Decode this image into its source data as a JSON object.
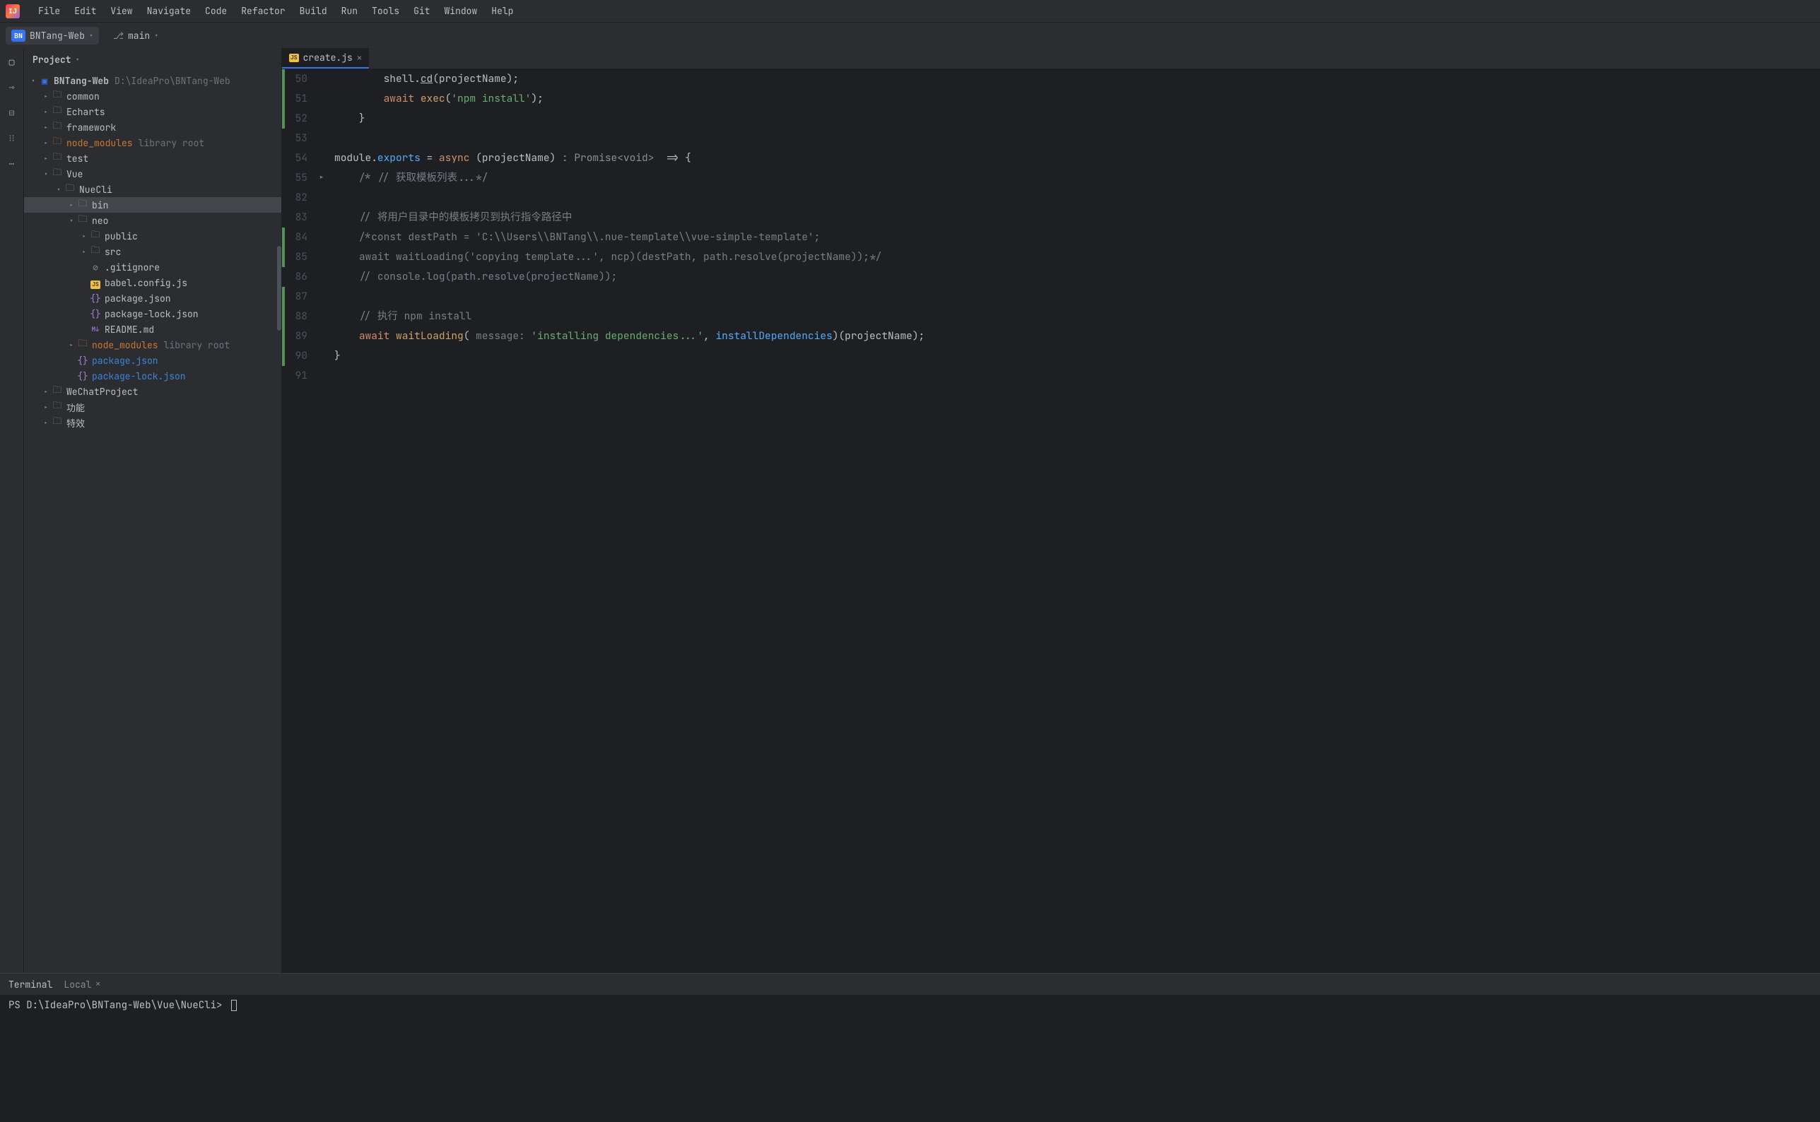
{
  "menu": [
    "File",
    "Edit",
    "View",
    "Navigate",
    "Code",
    "Refactor",
    "Build",
    "Run",
    "Tools",
    "Git",
    "Window",
    "Help"
  ],
  "project": {
    "badge": "BN",
    "name": "BNTang-Web",
    "branch": "main"
  },
  "panel": {
    "title": "Project"
  },
  "tree": {
    "root": {
      "name": "BNTang-Web",
      "path": "D:\\IdeaPro\\BNTang-Web"
    },
    "items": [
      {
        "indent": 1,
        "arrow": ">",
        "icon": "folder",
        "label": "common"
      },
      {
        "indent": 1,
        "arrow": ">",
        "icon": "folder",
        "label": "Echarts"
      },
      {
        "indent": 1,
        "arrow": ">",
        "icon": "folder",
        "label": "framework"
      },
      {
        "indent": 1,
        "arrow": ">",
        "icon": "excluded",
        "label": "node_modules",
        "hint": "library root"
      },
      {
        "indent": 1,
        "arrow": ">",
        "icon": "folder",
        "label": "test"
      },
      {
        "indent": 1,
        "arrow": "v",
        "icon": "folder",
        "label": "Vue"
      },
      {
        "indent": 2,
        "arrow": "v",
        "icon": "folder",
        "label": "NueCli"
      },
      {
        "indent": 3,
        "arrow": ">",
        "icon": "folder",
        "label": "bin",
        "selected": true
      },
      {
        "indent": 3,
        "arrow": "v",
        "icon": "folder",
        "label": "neo"
      },
      {
        "indent": 4,
        "arrow": ">",
        "icon": "folder",
        "label": "public"
      },
      {
        "indent": 4,
        "arrow": ">",
        "icon": "folder",
        "label": "src"
      },
      {
        "indent": 4,
        "arrow": "",
        "icon": "gitignore",
        "label": ".gitignore"
      },
      {
        "indent": 4,
        "arrow": "",
        "icon": "js",
        "label": "babel.config.js"
      },
      {
        "indent": 4,
        "arrow": "",
        "icon": "json",
        "label": "package.json"
      },
      {
        "indent": 4,
        "arrow": "",
        "icon": "json",
        "label": "package-lock.json"
      },
      {
        "indent": 4,
        "arrow": "",
        "icon": "md",
        "label": "README.md"
      },
      {
        "indent": 3,
        "arrow": ">",
        "icon": "excluded",
        "label": "node_modules",
        "hint": "library root"
      },
      {
        "indent": 3,
        "arrow": "",
        "icon": "json",
        "label": "package.json",
        "modified": true
      },
      {
        "indent": 3,
        "arrow": "",
        "icon": "json",
        "label": "package-lock.json",
        "modified": true
      },
      {
        "indent": 1,
        "arrow": ">",
        "icon": "folder",
        "label": "WeChatProject"
      },
      {
        "indent": 1,
        "arrow": ">",
        "icon": "folder",
        "label": "功能"
      },
      {
        "indent": 1,
        "arrow": ">",
        "icon": "folder",
        "label": "特效"
      }
    ]
  },
  "tab": {
    "icon": "JS",
    "name": "create.js"
  },
  "code": {
    "lines": [
      {
        "num": "50",
        "vcs": true,
        "fold": "",
        "html": "        shell.<u>cd</u>(projectName);"
      },
      {
        "num": "51",
        "vcs": true,
        "fold": "",
        "html": "        <span class='kw'>await</span> <span class='call'>exec</span>(<span class='str'>'npm install'</span>);"
      },
      {
        "num": "52",
        "vcs": true,
        "fold": "",
        "html": "    }"
      },
      {
        "num": "53",
        "vcs": false,
        "fold": "",
        "html": ""
      },
      {
        "num": "54",
        "vcs": false,
        "fold": "",
        "html": "module.<span class='fn'>exports</span> = <span class='kw'>async</span> (projectName)<span class='type'> : Promise&lt;void&gt; </span> =&gt; {"
      },
      {
        "num": "55",
        "vcs": false,
        "fold": ">",
        "html": "    <span class='com'>/* // 获取模板列表...*/</span>"
      },
      {
        "num": "82",
        "vcs": false,
        "fold": "",
        "html": ""
      },
      {
        "num": "83",
        "vcs": false,
        "fold": "",
        "html": "    <span class='com'>// 将用户目录中的模板拷贝到执行指令路径中</span>"
      },
      {
        "num": "84",
        "vcs": true,
        "fold": "",
        "html": "    <span class='com'>/*const destPath = 'C:\\\\Users\\\\BNTang\\\\.nue-template\\\\vue-simple-template';</span>"
      },
      {
        "num": "85",
        "vcs": true,
        "fold": "",
        "html": "    <span class='com'>await waitLoading('copying template...', ncp)(destPath, path.resolve(projectName));*/</span>"
      },
      {
        "num": "86",
        "vcs": false,
        "fold": "",
        "html": "    <span class='com'>// console.log(path.resolve(projectName));</span>"
      },
      {
        "num": "87",
        "vcs": true,
        "fold": "",
        "html": ""
      },
      {
        "num": "88",
        "vcs": true,
        "fold": "",
        "html": "    <span class='com'>// 执行 npm install</span>"
      },
      {
        "num": "89",
        "vcs": true,
        "fold": "",
        "html": "    <span class='kw'>await</span> <span class='call'>waitLoading</span>(<span class='param'> message: </span><span class='str'>'installing dependencies...'</span>, <span class='fn'>installDependencies</span>)(projectName);"
      },
      {
        "num": "90",
        "vcs": true,
        "fold": "",
        "html": "}"
      },
      {
        "num": "91",
        "vcs": false,
        "fold": "",
        "html": ""
      }
    ]
  },
  "terminal": {
    "tab1": "Terminal",
    "tab2": "Local",
    "prompt": "PS D:\\IdeaPro\\BNTang-Web\\Vue\\NueCli> "
  }
}
